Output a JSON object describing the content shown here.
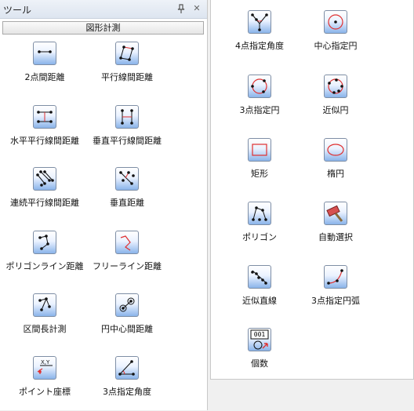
{
  "panel": {
    "title": "ツール",
    "pin": " ⊥",
    "close": "✕"
  },
  "section": {
    "label": "図形計測"
  },
  "left_tools": [
    {
      "label": "2点間距離",
      "icon": "two-point-distance-icon"
    },
    {
      "label": "平行線間距離",
      "icon": "parallel-lines-distance-icon"
    },
    {
      "label": "水平平行線間距離",
      "icon": "horizontal-parallel-distance-icon"
    },
    {
      "label": "垂直平行線間距離",
      "icon": "vertical-parallel-distance-icon"
    },
    {
      "label": "連続平行線間距離",
      "icon": "continuous-parallel-distance-icon"
    },
    {
      "label": "垂直距離",
      "icon": "perpendicular-distance-icon"
    },
    {
      "label": "ポリゴンライン距離",
      "icon": "polygon-line-distance-icon"
    },
    {
      "label": "フリーライン距離",
      "icon": "free-line-distance-icon"
    },
    {
      "label": "区間長計測",
      "icon": "segment-length-icon"
    },
    {
      "label": "円中心間距離",
      "icon": "circle-center-distance-icon"
    },
    {
      "label": "ポイント座標",
      "icon": "point-coordinate-icon"
    },
    {
      "label": "3点指定角度",
      "icon": "three-point-angle-icon"
    }
  ],
  "right_tools": [
    {
      "label": "4点指定角度",
      "icon": "four-point-angle-icon"
    },
    {
      "label": "中心指定円",
      "icon": "center-circle-icon"
    },
    {
      "label": "3点指定円",
      "icon": "three-point-circle-icon"
    },
    {
      "label": "近似円",
      "icon": "approx-circle-icon"
    },
    {
      "label": "矩形",
      "icon": "rectangle-icon"
    },
    {
      "label": "楕円",
      "icon": "ellipse-icon"
    },
    {
      "label": "ポリゴン",
      "icon": "polygon-icon"
    },
    {
      "label": "自動選択",
      "icon": "auto-select-icon"
    },
    {
      "label": "近似直線",
      "icon": "approx-line-icon"
    },
    {
      "label": "3点指定円弧",
      "icon": "three-point-arc-icon"
    },
    {
      "label": "個数",
      "icon": "count-icon",
      "badge": "001"
    }
  ],
  "colors": {
    "accent_red": "#e03030",
    "icon_blue": "#8ab4ea"
  }
}
